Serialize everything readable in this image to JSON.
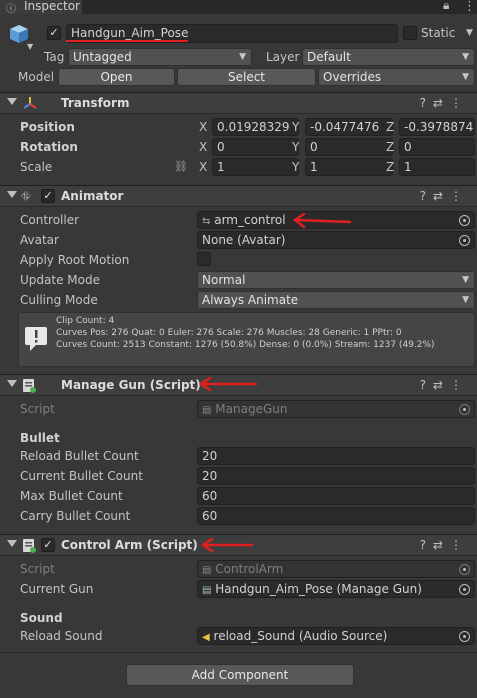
{
  "tab": {
    "title": "Inspector",
    "lock_icon": "lock-icon",
    "menu_icon": "kebab-icon"
  },
  "object": {
    "name": "Handgun_Aim_Pose",
    "static_label": "Static",
    "tag_label": "Tag",
    "tag_value": "Untagged",
    "layer_label": "Layer",
    "layer_value": "Default",
    "model_label": "Model",
    "open_label": "Open",
    "select_label": "Select",
    "overrides_label": "Overrides"
  },
  "transform": {
    "title": "Transform",
    "position_label": "Position",
    "rotation_label": "Rotation",
    "scale_label": "Scale",
    "x": "X",
    "y": "Y",
    "z": "Z",
    "position": [
      "0.01928329",
      "-0.0477476",
      "-0.3978874"
    ],
    "rotation": [
      "0",
      "0",
      "0"
    ],
    "scale": [
      "1",
      "1",
      "1"
    ]
  },
  "animator": {
    "title": "Animator",
    "controller_label": "Controller",
    "controller_value": "arm_control",
    "avatar_label": "Avatar",
    "avatar_value": "None (Avatar)",
    "apply_root_label": "Apply Root Motion",
    "update_mode_label": "Update Mode",
    "update_mode_value": "Normal",
    "culling_mode_label": "Culling Mode",
    "culling_mode_value": "Always Animate",
    "info_line1": "Clip Count: 4",
    "info_line2": "Curves Pos: 276 Quat: 0 Euler: 276 Scale: 276 Muscles: 28 Generic: 1 PPtr: 0",
    "info_line3": "Curves Count: 2513 Constant: 1276 (50.8%) Dense: 0 (0.0%) Stream: 1237 (49.2%)"
  },
  "manage_gun": {
    "title": "Manage Gun (Script)",
    "script_label": "Script",
    "script_value": "ManageGun",
    "section": "Bullet",
    "fields": [
      {
        "label": "Reload Bullet Count",
        "value": "20"
      },
      {
        "label": "Current Bullet Count",
        "value": "20"
      },
      {
        "label": "Max Bullet Count",
        "value": "60"
      },
      {
        "label": "Carry Bullet Count",
        "value": "60"
      }
    ]
  },
  "control_arm": {
    "title": "Control Arm (Script)",
    "script_label": "Script",
    "script_value": "ControlArm",
    "current_gun_label": "Current Gun",
    "current_gun_value": "Handgun_Aim_Pose (Manage Gun)",
    "section": "Sound",
    "reload_sound_label": "Reload Sound",
    "reload_sound_value": "reload_Sound (Audio Source)"
  },
  "add_component_label": "Add Component",
  "colors": {
    "annotation": "#e02020",
    "background": "#383838"
  }
}
